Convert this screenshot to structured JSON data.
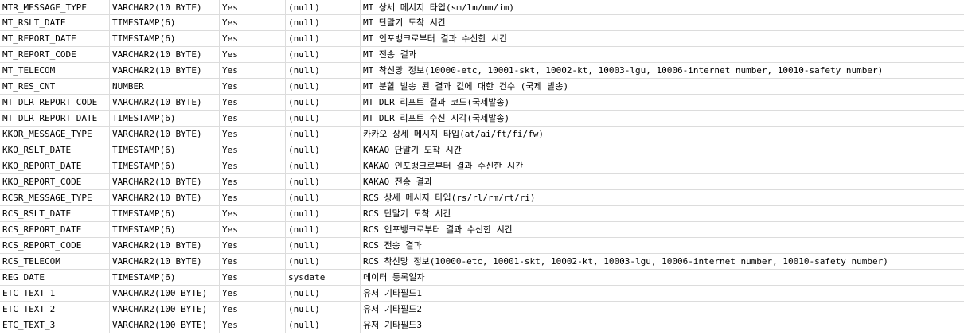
{
  "rows": [
    {
      "name": "MTR_MESSAGE_TYPE",
      "type": "VARCHAR2(10 BYTE)",
      "nullable": "Yes",
      "default": "(null)",
      "comment": "MT 상세 메시지 타입(sm/lm/mm/im)"
    },
    {
      "name": "MT_RSLT_DATE",
      "type": "TIMESTAMP(6)",
      "nullable": "Yes",
      "default": "(null)",
      "comment": "MT 단말기 도착 시간"
    },
    {
      "name": "MT_REPORT_DATE",
      "type": "TIMESTAMP(6)",
      "nullable": "Yes",
      "default": "(null)",
      "comment": "MT 인포뱅크로부터 결과 수신한 시간"
    },
    {
      "name": "MT_REPORT_CODE",
      "type": "VARCHAR2(10 BYTE)",
      "nullable": "Yes",
      "default": "(null)",
      "comment": "MT 전송 결과"
    },
    {
      "name": "MT_TELECOM",
      "type": "VARCHAR2(10 BYTE)",
      "nullable": "Yes",
      "default": "(null)",
      "comment": "MT 착신망 정보(10000-etc, 10001-skt, 10002-kt, 10003-lgu, 10006-internet number, 10010-safety number)"
    },
    {
      "name": "MT_RES_CNT",
      "type": "NUMBER",
      "nullable": "Yes",
      "default": "(null)",
      "comment": "MT 분할 발송 된 결과 값에 대한 건수 (국제 발송)"
    },
    {
      "name": "MT_DLR_REPORT_CODE",
      "type": "VARCHAR2(10 BYTE)",
      "nullable": "Yes",
      "default": "(null)",
      "comment": "MT DLR 리포트 결과 코드(국제발송)"
    },
    {
      "name": "MT_DLR_REPORT_DATE",
      "type": "TIMESTAMP(6)",
      "nullable": "Yes",
      "default": "(null)",
      "comment": "MT DLR 리포트 수신 시각(국제발송)"
    },
    {
      "name": "KKOR_MESSAGE_TYPE",
      "type": "VARCHAR2(10 BYTE)",
      "nullable": "Yes",
      "default": "(null)",
      "comment": "카카오 상세 메시지 타입(at/ai/ft/fi/fw)"
    },
    {
      "name": "KKO_RSLT_DATE",
      "type": "TIMESTAMP(6)",
      "nullable": "Yes",
      "default": "(null)",
      "comment": "KAKAO 단말기 도착 시간"
    },
    {
      "name": "KKO_REPORT_DATE",
      "type": "TIMESTAMP(6)",
      "nullable": "Yes",
      "default": "(null)",
      "comment": "KAKAO 인포뱅크로부터 결과 수신한 시간"
    },
    {
      "name": "KKO_REPORT_CODE",
      "type": "VARCHAR2(10 BYTE)",
      "nullable": "Yes",
      "default": "(null)",
      "comment": "KAKAO 전송 결과"
    },
    {
      "name": "RCSR_MESSAGE_TYPE",
      "type": "VARCHAR2(10 BYTE)",
      "nullable": "Yes",
      "default": "(null)",
      "comment": "RCS 상세 메시지 타입(rs/rl/rm/rt/ri)"
    },
    {
      "name": "RCS_RSLT_DATE",
      "type": "TIMESTAMP(6)",
      "nullable": "Yes",
      "default": "(null)",
      "comment": "RCS 단말기 도착 시간"
    },
    {
      "name": "RCS_REPORT_DATE",
      "type": "TIMESTAMP(6)",
      "nullable": "Yes",
      "default": "(null)",
      "comment": "RCS 인포뱅크로부터 결과 수신한 시간"
    },
    {
      "name": "RCS_REPORT_CODE",
      "type": "VARCHAR2(10 BYTE)",
      "nullable": "Yes",
      "default": "(null)",
      "comment": "RCS 전송 결과"
    },
    {
      "name": "RCS_TELECOM",
      "type": "VARCHAR2(10 BYTE)",
      "nullable": "Yes",
      "default": "(null)",
      "comment": "RCS 착신망 정보(10000-etc, 10001-skt, 10002-kt, 10003-lgu, 10006-internet number, 10010-safety number)"
    },
    {
      "name": "REG_DATE",
      "type": "TIMESTAMP(6)",
      "nullable": "Yes",
      "default": "sysdate",
      "comment": "데이터 등록일자"
    },
    {
      "name": "ETC_TEXT_1",
      "type": "VARCHAR2(100 BYTE)",
      "nullable": "Yes",
      "default": "(null)",
      "comment": "유저 기타필드1"
    },
    {
      "name": "ETC_TEXT_2",
      "type": "VARCHAR2(100 BYTE)",
      "nullable": "Yes",
      "default": "(null)",
      "comment": "유저 기타필드2"
    },
    {
      "name": "ETC_TEXT_3",
      "type": "VARCHAR2(100 BYTE)",
      "nullable": "Yes",
      "default": "(null)",
      "comment": "유저 기타필드3"
    }
  ]
}
